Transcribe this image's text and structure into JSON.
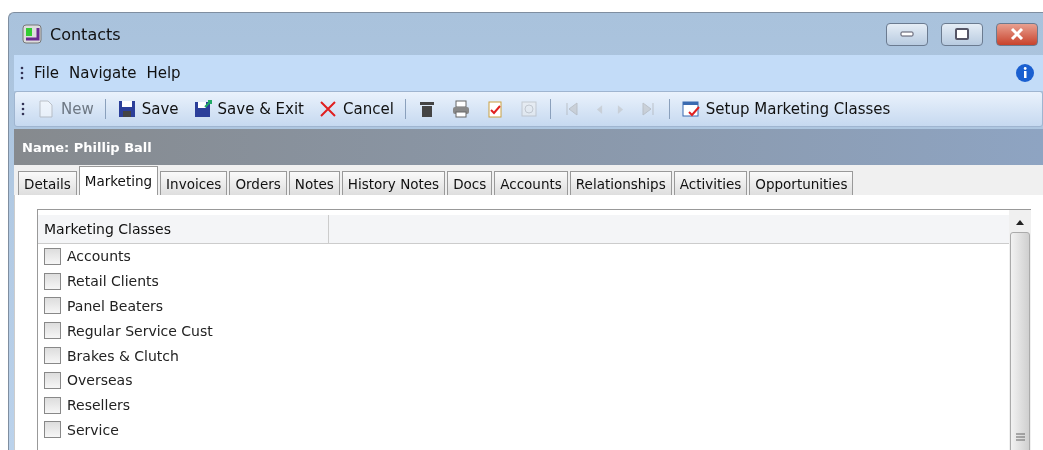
{
  "window": {
    "title": "Contacts"
  },
  "menu": [
    "File",
    "Navigate",
    "Help"
  ],
  "toolbar": [
    {
      "kind": "button",
      "label": "New",
      "disabled": true
    },
    {
      "kind": "separator"
    },
    {
      "kind": "button",
      "label": "Save",
      "disabled": false
    },
    {
      "kind": "button",
      "label": "Save & Exit",
      "disabled": false
    },
    {
      "kind": "button",
      "label": "Cancel",
      "disabled": false
    },
    {
      "kind": "separator"
    },
    {
      "kind": "button",
      "disabled": false
    },
    {
      "kind": "button",
      "disabled": false
    },
    {
      "kind": "button",
      "disabled": false
    },
    {
      "kind": "button",
      "disabled": true
    },
    {
      "kind": "separator"
    },
    {
      "kind": "button",
      "disabled": true
    },
    {
      "kind": "button",
      "disabled": true
    },
    {
      "kind": "button",
      "disabled": true
    },
    {
      "kind": "button",
      "disabled": true
    },
    {
      "kind": "separator"
    },
    {
      "kind": "button",
      "label": "Setup Marketing Classes",
      "disabled": false
    }
  ],
  "name_bar": "Name: Phillip Ball",
  "tabs": [
    {
      "label": "Details",
      "selected": false
    },
    {
      "label": "Marketing",
      "selected": true
    },
    {
      "label": "Invoices",
      "selected": false
    },
    {
      "label": "Orders",
      "selected": false
    },
    {
      "label": "Notes",
      "selected": false
    },
    {
      "label": "History Notes",
      "selected": false
    },
    {
      "label": "Docs",
      "selected": false
    },
    {
      "label": "Accounts",
      "selected": false
    },
    {
      "label": "Relationships",
      "selected": false
    },
    {
      "label": "Activities",
      "selected": false
    },
    {
      "label": "Opportunities",
      "selected": false
    }
  ],
  "list": {
    "column": "Marketing Classes",
    "items": [
      {
        "label": "Accounts",
        "checked": false
      },
      {
        "label": "Retail Clients",
        "checked": false
      },
      {
        "label": "Panel Beaters",
        "checked": false
      },
      {
        "label": "Regular Service Cust",
        "checked": false
      },
      {
        "label": "Brakes & Clutch",
        "checked": false
      },
      {
        "label": "Overseas",
        "checked": false
      },
      {
        "label": "Resellers",
        "checked": false
      },
      {
        "label": "Service",
        "checked": false
      }
    ]
  }
}
